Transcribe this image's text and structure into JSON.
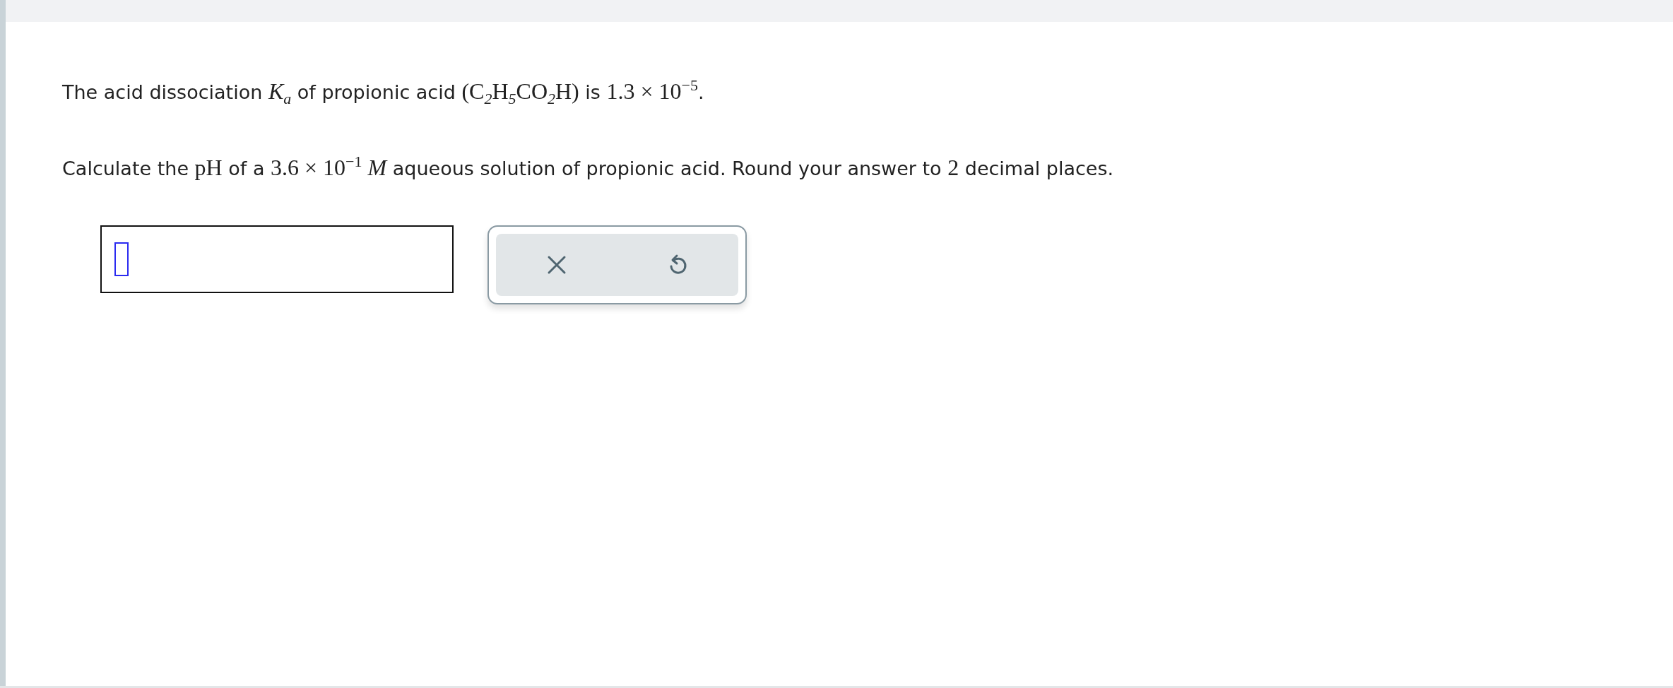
{
  "question": {
    "paragraphs": [
      [
        {
          "kind": "text",
          "text": "The acid dissociation "
        },
        {
          "kind": "math",
          "text": "*K*$_{a}$"
        },
        {
          "kind": "text",
          "text": " of propionic acid "
        },
        {
          "kind": "math",
          "text": "(C$_{2}$H$_{5}$CO$_{2}$H)"
        },
        {
          "kind": "text",
          "text": " is "
        },
        {
          "kind": "math",
          "text": "1.3 × 10$^{−5}$"
        },
        {
          "kind": "text",
          "text": "."
        }
      ],
      [
        {
          "kind": "text",
          "text": "Calculate the "
        },
        {
          "kind": "math",
          "text": "pH"
        },
        {
          "kind": "text",
          "text": " of a "
        },
        {
          "kind": "math",
          "text": "3.6 × 10$^{−1}$ *M*"
        },
        {
          "kind": "text",
          "text": " aqueous solution of propionic acid. Round your answer to "
        },
        {
          "kind": "math",
          "text": "2"
        },
        {
          "kind": "text",
          "text": " decimal places."
        }
      ]
    ]
  },
  "tools": [
    {
      "kind": "clear"
    },
    {
      "kind": "undo"
    }
  ]
}
